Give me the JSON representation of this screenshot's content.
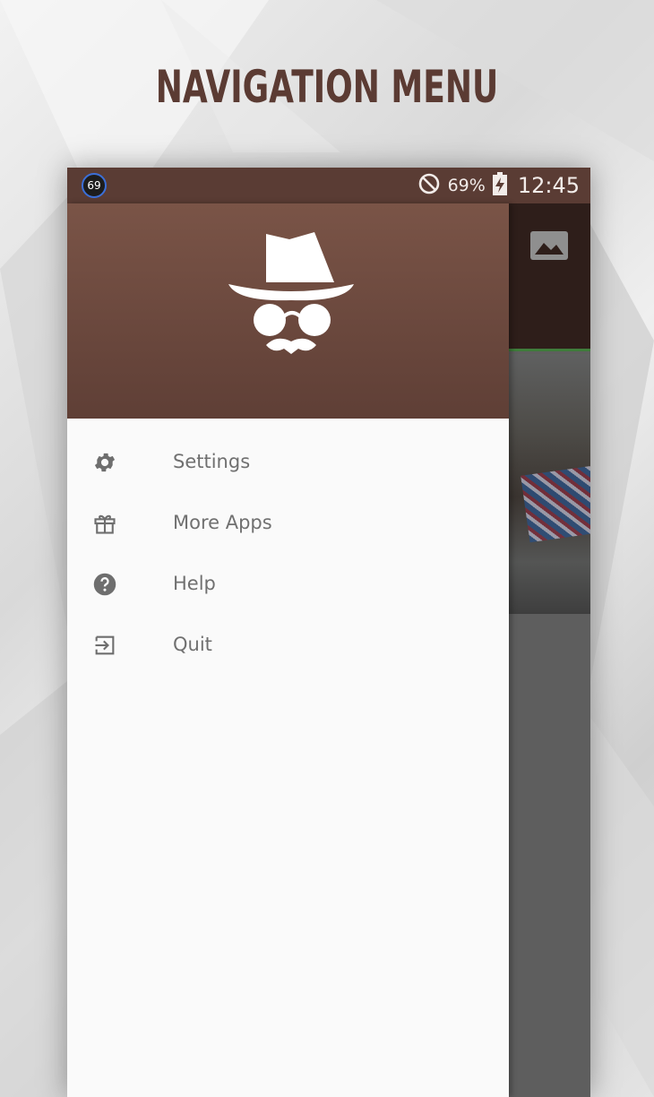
{
  "headline": "NAVIGATION MENU",
  "status": {
    "notification_count": "69",
    "battery": "69%",
    "time": "12:45",
    "icons": [
      "do-not-disturb-icon",
      "battery-charging-icon"
    ]
  },
  "menu": {
    "items": [
      {
        "label": "Settings",
        "icon": "gear-icon"
      },
      {
        "label": "More Apps",
        "icon": "gift-icon"
      },
      {
        "label": "Help",
        "icon": "help-icon"
      },
      {
        "label": "Quit",
        "icon": "exit-icon"
      }
    ]
  },
  "colors": {
    "brand": "#5b3b33",
    "header_top": "#7a5447",
    "header_bottom": "#5f3f36",
    "statusbar": "#5a3c34",
    "menu_text": "#707070"
  }
}
